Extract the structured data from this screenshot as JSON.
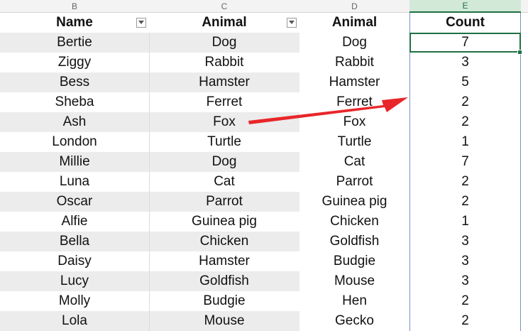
{
  "column_letters": [
    "B",
    "C",
    "D",
    "E"
  ],
  "headers": {
    "name": "Name",
    "animal": "Animal",
    "animal2": "Animal",
    "count": "Count"
  },
  "rows": [
    {
      "name": "Bertie",
      "animal": "Dog",
      "animal2": "Dog",
      "count": "7"
    },
    {
      "name": "Ziggy",
      "animal": "Rabbit",
      "animal2": "Rabbit",
      "count": "3"
    },
    {
      "name": "Bess",
      "animal": "Hamster",
      "animal2": "Hamster",
      "count": "5"
    },
    {
      "name": "Sheba",
      "animal": "Ferret",
      "animal2": "Ferret",
      "count": "2"
    },
    {
      "name": "Ash",
      "animal": "Fox",
      "animal2": "Fox",
      "count": "2"
    },
    {
      "name": "London",
      "animal": "Turtle",
      "animal2": "Turtle",
      "count": "1"
    },
    {
      "name": "Millie",
      "animal": "Dog",
      "animal2": "Cat",
      "count": "7"
    },
    {
      "name": "Luna",
      "animal": "Cat",
      "animal2": "Parrot",
      "count": "2"
    },
    {
      "name": "Oscar",
      "animal": "Parrot",
      "animal2": "Guinea pig",
      "count": "2"
    },
    {
      "name": "Alfie",
      "animal": "Guinea pig",
      "animal2": "Chicken",
      "count": "1"
    },
    {
      "name": "Bella",
      "animal": "Chicken",
      "animal2": "Goldfish",
      "count": "3"
    },
    {
      "name": "Daisy",
      "animal": "Hamster",
      "animal2": "Budgie",
      "count": "3"
    },
    {
      "name": "Lucy",
      "animal": "Goldfish",
      "animal2": "Mouse",
      "count": "3"
    },
    {
      "name": "Molly",
      "animal": "Budgie",
      "animal2": "Hen",
      "count": "2"
    },
    {
      "name": "Lola",
      "animal": "Mouse",
      "animal2": "Gecko",
      "count": "2"
    }
  ],
  "colors": {
    "band": "#ececec",
    "selection": "#1e7145",
    "arrow": "#e8262a"
  },
  "icons": {
    "filter": "filter-dropdown-icon",
    "arrow": "red-annotation-arrow"
  }
}
